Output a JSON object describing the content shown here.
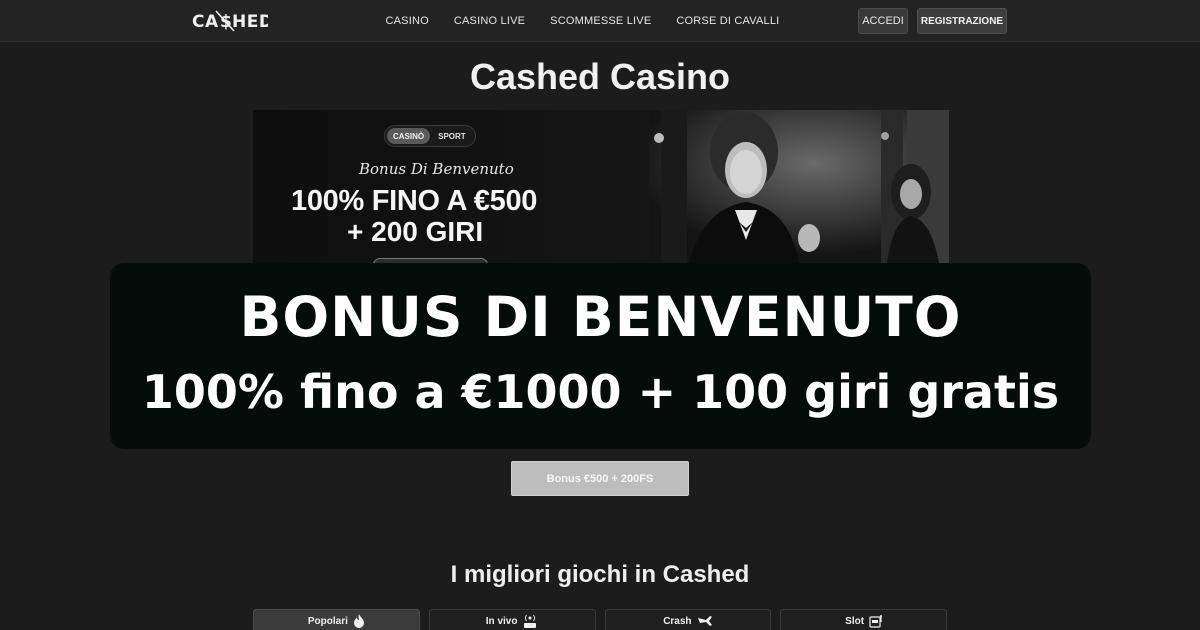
{
  "header": {
    "logo_text": "CASHED",
    "nav": [
      "CASINO",
      "CASINO LIVE",
      "SCOMMESSE LIVE",
      "CORSE DI CAVALLI"
    ],
    "login_label": "ACCEDI",
    "register_label": "REGISTRAZIONE"
  },
  "page_title": "Cashed Casino",
  "banner": {
    "toggle": [
      "CASINÒ",
      "SPORT"
    ],
    "subtitle": "Bonus Di Benvenuto",
    "line1": "100% FINO A €500",
    "line2": "+ 200 GIRI"
  },
  "overlay": {
    "title": "BONUS DI BENVENUTO",
    "subtitle": "100% fino a €1000 + 100 giri gratis"
  },
  "bonus_button": "Bonus €500 + 200FS",
  "games": {
    "title": "I migliori giochi in Cashed",
    "tabs": [
      {
        "label": "Popolari",
        "icon": "flame-icon",
        "active": true
      },
      {
        "label": "In vivo",
        "icon": "live-broadcast-icon",
        "active": false
      },
      {
        "label": "Crash",
        "icon": "plane-crash-icon",
        "active": false
      },
      {
        "label": "Slot",
        "icon": "slot-machine-icon",
        "active": false
      }
    ]
  },
  "colors": {
    "background": "#1c1c1c",
    "header": "#232323",
    "overlay": "#050c09",
    "bonus_button": "#bdbdbd"
  }
}
